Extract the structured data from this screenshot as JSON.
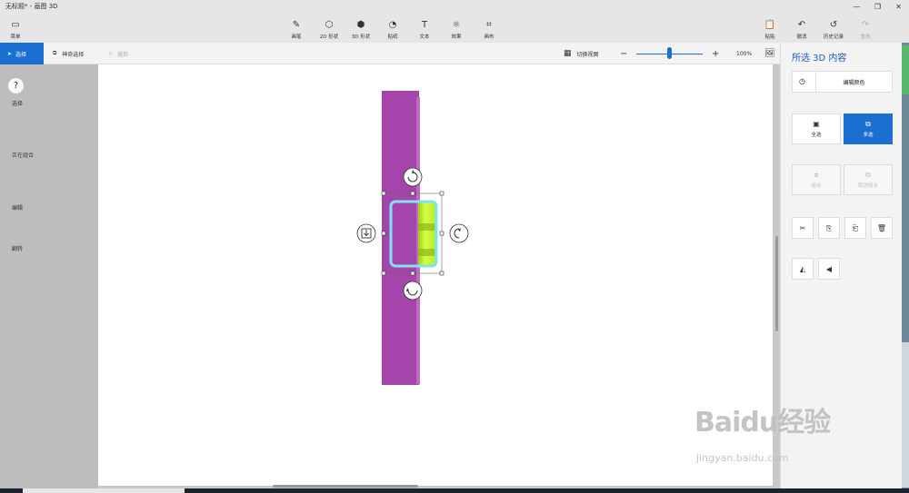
{
  "window": {
    "title": "无标题* - 画图 3D"
  },
  "toolbar": {
    "menu": "菜单",
    "brushes": "画笔",
    "shapes2d": "2D 形状",
    "shapes3d": "3D 形状",
    "stickers": "贴纸",
    "text": "文本",
    "effects": "效果",
    "canvas": "画布",
    "paste": "粘贴",
    "undo": "撤消",
    "history": "历史记录",
    "redo": "重做"
  },
  "subbar": {
    "select": "选择",
    "magic_select": "神奇选择",
    "crop": "裁剪",
    "toggle_view": "切换视图",
    "zoom": "100%",
    "zoom_level": 0.5
  },
  "panel": {
    "title": "所选 3D 内容",
    "edit_color": "编辑颜色",
    "select_section": "选择",
    "select_all": "全选",
    "multi_select": "多选",
    "grouping_section": "正在组合",
    "group": "组合",
    "ungroup": "取消组合",
    "edit_section": "编辑",
    "flip_section": "翻转"
  },
  "help": "?",
  "colors": {
    "accent": "#1a6fd0",
    "purple_object": "#a544aa",
    "yellow_object": "#ccff33",
    "selection": "#7fe3f5"
  },
  "watermark": {
    "brand": "Baidu经验",
    "url": "jingyan.baidu.com"
  }
}
